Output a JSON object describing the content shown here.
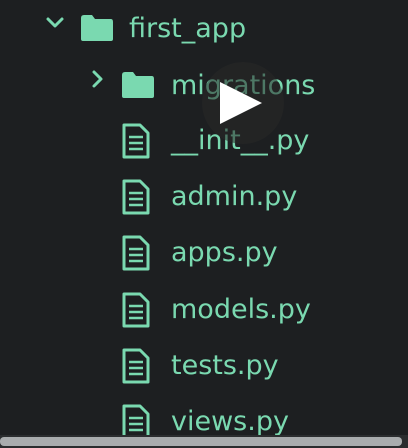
{
  "colors": {
    "background": "#1d1f21",
    "accent": "#7ad9b0",
    "file_icon": "#7ad9b0"
  },
  "tree": {
    "root": {
      "name": "first_app",
      "expanded": true,
      "icon": "folder-icon"
    },
    "children": [
      {
        "name": "migrations",
        "type": "folder",
        "expanded": false,
        "icon": "folder-icon"
      },
      {
        "name": "__init__.py",
        "type": "file",
        "icon": "file-icon"
      },
      {
        "name": "admin.py",
        "type": "file",
        "icon": "file-icon"
      },
      {
        "name": "apps.py",
        "type": "file",
        "icon": "file-icon"
      },
      {
        "name": "models.py",
        "type": "file",
        "icon": "file-icon"
      },
      {
        "name": "tests.py",
        "type": "file",
        "icon": "file-icon"
      },
      {
        "name": "views.py",
        "type": "file",
        "icon": "file-icon"
      }
    ]
  },
  "overlay": {
    "icon": "play-icon"
  }
}
